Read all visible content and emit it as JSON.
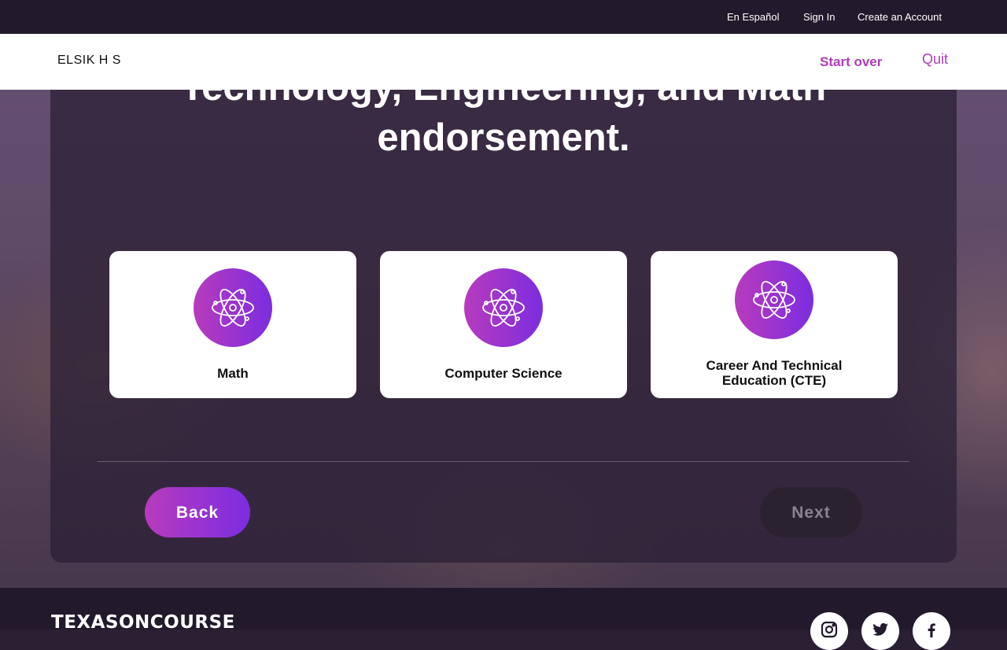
{
  "topbar": {
    "spanish": "En Español",
    "sign_in": "Sign In",
    "create_account": "Create an Account"
  },
  "header": {
    "school_name": "ELSIK H S",
    "start_over": "Start over",
    "quit": "Quit"
  },
  "main": {
    "heading_line1": "Technology, Engineering, and Math",
    "heading_line2": "endorsement.",
    "cards": [
      {
        "label": "Math",
        "icon": "atom-icon"
      },
      {
        "label": "Computer Science",
        "icon": "atom-icon"
      },
      {
        "label": "Career And Technical Education (CTE)",
        "icon": "atom-icon"
      }
    ],
    "back_label": "Back",
    "next_label": "Next"
  },
  "footer": {
    "logo": "TEXASONCOURSE",
    "social": [
      "instagram-icon",
      "twitter-icon",
      "facebook-icon"
    ]
  },
  "colors": {
    "accent_start": "#b83bbd",
    "accent_end": "#7b2de0",
    "dark_bar": "#221a2c",
    "link_purple": "#b23bbd"
  }
}
